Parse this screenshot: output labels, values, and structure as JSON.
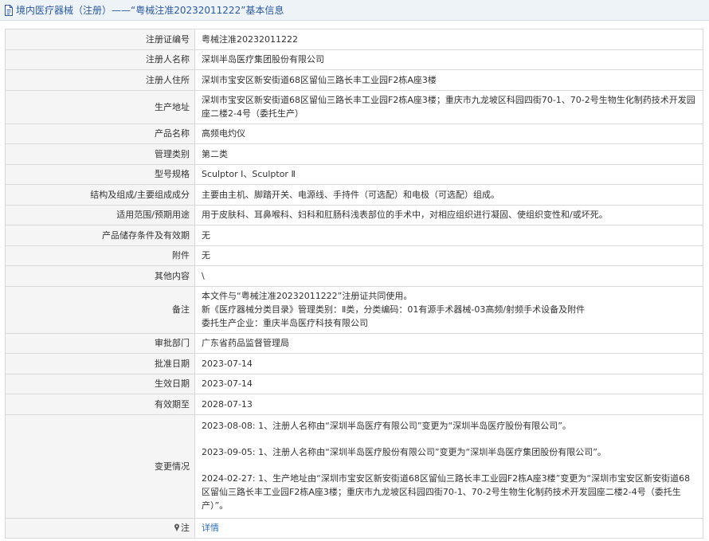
{
  "header": {
    "title": "境内医疗器械（注册）——“粤械注准20232011222”基本信息"
  },
  "rows": {
    "reg_no": {
      "label": "注册证编号",
      "value": "粤械注准20232011222"
    },
    "registrant": {
      "label": "注册人名称",
      "value": "深圳半岛医疗集团股份有限公司"
    },
    "address": {
      "label": "注册人住所",
      "value": "深圳市宝安区新安街道68区留仙三路长丰工业园F2栋A座3楼"
    },
    "prod_address": {
      "label": "生产地址",
      "value": "深圳市宝安区新安街道68区留仙三路长丰工业园F2栋A座3楼；重庆市九龙坡区科园四街70-1、70-2号生物生化制药技术开发园座二楼2-4号（委托生产）"
    },
    "product_name": {
      "label": "产品名称",
      "value": "高频电灼仪"
    },
    "category": {
      "label": "管理类别",
      "value": "第二类"
    },
    "model": {
      "label": "型号规格",
      "value": "Sculptor Ⅰ、Sculptor Ⅱ"
    },
    "structure": {
      "label": "结构及组成/主要组成成分",
      "value": "主要由主机、脚踏开关、电源线、手持件（可选配）和电极（可选配）组成。"
    },
    "scope": {
      "label": "适用范围/预期用途",
      "value": "用于皮肤科、耳鼻喉科、妇科和肛肠科浅表部位的手术中，对相应组织进行凝固、使组织变性和/或坏死。"
    },
    "storage": {
      "label": "产品储存条件及有效期",
      "value": "无"
    },
    "attachment": {
      "label": "附件",
      "value": "无"
    },
    "other": {
      "label": "其他内容",
      "value": "\\"
    },
    "remarks": {
      "label": "备注",
      "lines": [
        "本文件与“粤械注准20232011222”注册证共同使用。",
        "新《医疗器械分类目录》管理类别：Ⅱ类，分类编码：01有源手术器械-03高频/射频手术设备及附件",
        "委托生产企业：重庆半岛医疗科技有限公司"
      ]
    },
    "authority": {
      "label": "审批部门",
      "value": "广东省药品监督管理局"
    },
    "approval_date": {
      "label": "批准日期",
      "value": "2023-07-14"
    },
    "effective_date": {
      "label": "生效日期",
      "value": "2023-07-14"
    },
    "expiry_date": {
      "label": "有效期至",
      "value": "2028-07-13"
    },
    "changes": {
      "label": "变更情况",
      "items": [
        "2023-08-08: 1、注册人名称由“深圳半岛医疗有限公司”变更为“深圳半岛医疗股份有限公司”。",
        "2023-09-05: 1、注册人名称由“深圳半岛医疗股份有限公司”变更为“深圳半岛医疗集团股份有限公司”。",
        "2024-02-27: 1、生产地址由“深圳市宝安区新安街道68区留仙三路长丰工业园F2栋A座3楼”变更为“深圳市宝安区新安街道68区留仙三路长丰工业园F2栋A座3楼；重庆市九龙坡区科园四街70-1、70-2号生物生化制药技术开发园座二楼2-4号（委托生产）”。"
      ]
    },
    "note": {
      "label": "注",
      "link_text": "详情",
      "icon": "pin-icon"
    }
  },
  "colors": {
    "title_text": "#2c5aa0",
    "title_bg": "#eef3f8",
    "label_bg": "#f5f5f5",
    "border": "#d9d9d9",
    "link": "#2c6fbb"
  }
}
